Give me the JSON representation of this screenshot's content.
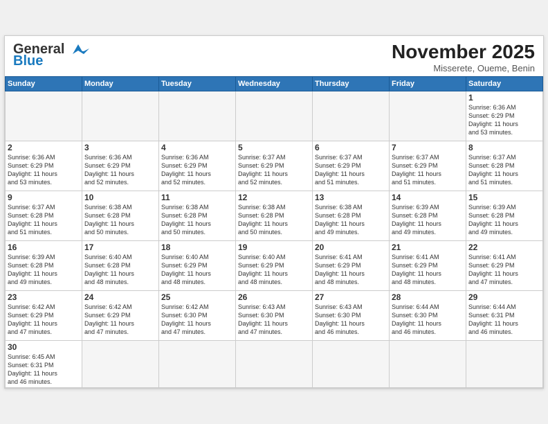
{
  "header": {
    "logo_general": "General",
    "logo_blue": "Blue",
    "month_title": "November 2025",
    "subtitle": "Misserete, Oueme, Benin"
  },
  "weekdays": [
    "Sunday",
    "Monday",
    "Tuesday",
    "Wednesday",
    "Thursday",
    "Friday",
    "Saturday"
  ],
  "weeks": [
    [
      {
        "day": "",
        "info": ""
      },
      {
        "day": "",
        "info": ""
      },
      {
        "day": "",
        "info": ""
      },
      {
        "day": "",
        "info": ""
      },
      {
        "day": "",
        "info": ""
      },
      {
        "day": "",
        "info": ""
      },
      {
        "day": "1",
        "info": "Sunrise: 6:36 AM\nSunset: 6:29 PM\nDaylight: 11 hours\nand 53 minutes."
      }
    ],
    [
      {
        "day": "2",
        "info": "Sunrise: 6:36 AM\nSunset: 6:29 PM\nDaylight: 11 hours\nand 53 minutes."
      },
      {
        "day": "3",
        "info": "Sunrise: 6:36 AM\nSunset: 6:29 PM\nDaylight: 11 hours\nand 52 minutes."
      },
      {
        "day": "4",
        "info": "Sunrise: 6:36 AM\nSunset: 6:29 PM\nDaylight: 11 hours\nand 52 minutes."
      },
      {
        "day": "5",
        "info": "Sunrise: 6:37 AM\nSunset: 6:29 PM\nDaylight: 11 hours\nand 52 minutes."
      },
      {
        "day": "6",
        "info": "Sunrise: 6:37 AM\nSunset: 6:29 PM\nDaylight: 11 hours\nand 51 minutes."
      },
      {
        "day": "7",
        "info": "Sunrise: 6:37 AM\nSunset: 6:29 PM\nDaylight: 11 hours\nand 51 minutes."
      },
      {
        "day": "8",
        "info": "Sunrise: 6:37 AM\nSunset: 6:28 PM\nDaylight: 11 hours\nand 51 minutes."
      }
    ],
    [
      {
        "day": "9",
        "info": "Sunrise: 6:37 AM\nSunset: 6:28 PM\nDaylight: 11 hours\nand 51 minutes."
      },
      {
        "day": "10",
        "info": "Sunrise: 6:38 AM\nSunset: 6:28 PM\nDaylight: 11 hours\nand 50 minutes."
      },
      {
        "day": "11",
        "info": "Sunrise: 6:38 AM\nSunset: 6:28 PM\nDaylight: 11 hours\nand 50 minutes."
      },
      {
        "day": "12",
        "info": "Sunrise: 6:38 AM\nSunset: 6:28 PM\nDaylight: 11 hours\nand 50 minutes."
      },
      {
        "day": "13",
        "info": "Sunrise: 6:38 AM\nSunset: 6:28 PM\nDaylight: 11 hours\nand 49 minutes."
      },
      {
        "day": "14",
        "info": "Sunrise: 6:39 AM\nSunset: 6:28 PM\nDaylight: 11 hours\nand 49 minutes."
      },
      {
        "day": "15",
        "info": "Sunrise: 6:39 AM\nSunset: 6:28 PM\nDaylight: 11 hours\nand 49 minutes."
      }
    ],
    [
      {
        "day": "16",
        "info": "Sunrise: 6:39 AM\nSunset: 6:28 PM\nDaylight: 11 hours\nand 49 minutes."
      },
      {
        "day": "17",
        "info": "Sunrise: 6:40 AM\nSunset: 6:28 PM\nDaylight: 11 hours\nand 48 minutes."
      },
      {
        "day": "18",
        "info": "Sunrise: 6:40 AM\nSunset: 6:29 PM\nDaylight: 11 hours\nand 48 minutes."
      },
      {
        "day": "19",
        "info": "Sunrise: 6:40 AM\nSunset: 6:29 PM\nDaylight: 11 hours\nand 48 minutes."
      },
      {
        "day": "20",
        "info": "Sunrise: 6:41 AM\nSunset: 6:29 PM\nDaylight: 11 hours\nand 48 minutes."
      },
      {
        "day": "21",
        "info": "Sunrise: 6:41 AM\nSunset: 6:29 PM\nDaylight: 11 hours\nand 48 minutes."
      },
      {
        "day": "22",
        "info": "Sunrise: 6:41 AM\nSunset: 6:29 PM\nDaylight: 11 hours\nand 47 minutes."
      }
    ],
    [
      {
        "day": "23",
        "info": "Sunrise: 6:42 AM\nSunset: 6:29 PM\nDaylight: 11 hours\nand 47 minutes."
      },
      {
        "day": "24",
        "info": "Sunrise: 6:42 AM\nSunset: 6:29 PM\nDaylight: 11 hours\nand 47 minutes."
      },
      {
        "day": "25",
        "info": "Sunrise: 6:42 AM\nSunset: 6:30 PM\nDaylight: 11 hours\nand 47 minutes."
      },
      {
        "day": "26",
        "info": "Sunrise: 6:43 AM\nSunset: 6:30 PM\nDaylight: 11 hours\nand 47 minutes."
      },
      {
        "day": "27",
        "info": "Sunrise: 6:43 AM\nSunset: 6:30 PM\nDaylight: 11 hours\nand 46 minutes."
      },
      {
        "day": "28",
        "info": "Sunrise: 6:44 AM\nSunset: 6:30 PM\nDaylight: 11 hours\nand 46 minutes."
      },
      {
        "day": "29",
        "info": "Sunrise: 6:44 AM\nSunset: 6:31 PM\nDaylight: 11 hours\nand 46 minutes."
      }
    ],
    [
      {
        "day": "30",
        "info": "Sunrise: 6:45 AM\nSunset: 6:31 PM\nDaylight: 11 hours\nand 46 minutes."
      },
      {
        "day": "",
        "info": ""
      },
      {
        "day": "",
        "info": ""
      },
      {
        "day": "",
        "info": ""
      },
      {
        "day": "",
        "info": ""
      },
      {
        "day": "",
        "info": ""
      },
      {
        "day": "",
        "info": ""
      }
    ]
  ]
}
